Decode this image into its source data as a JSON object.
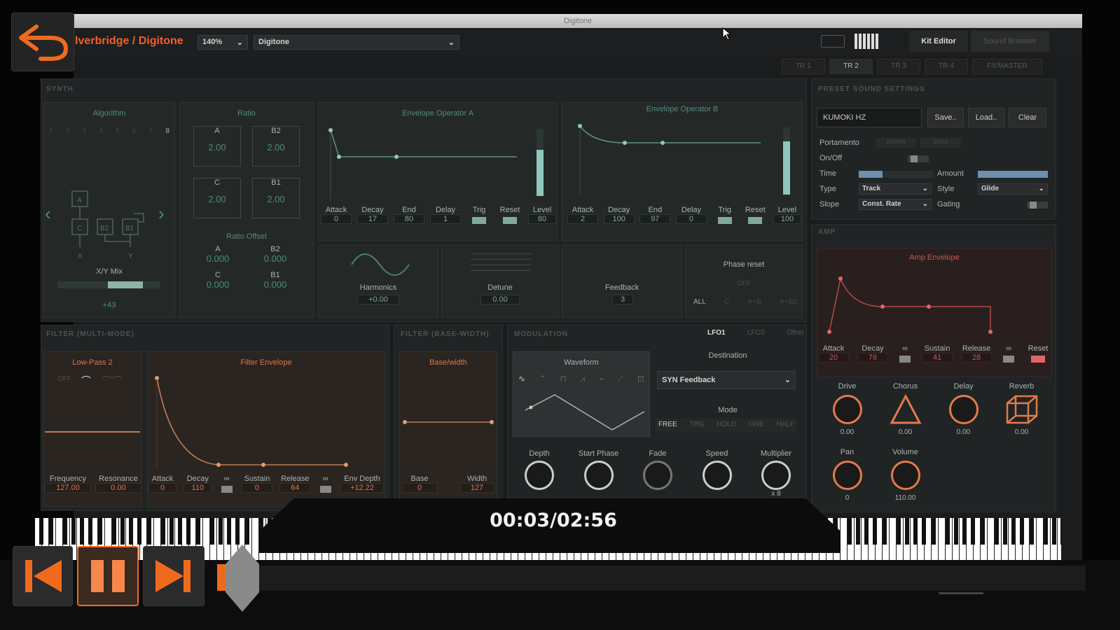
{
  "window": {
    "title": "Digitone"
  },
  "header": {
    "breadcrumb": "lverbridge / Digitone",
    "zoom": "140%",
    "device": "Digitone",
    "kit_editor": "Kit Editor",
    "sound_browser": "Sound Browser",
    "tracks": [
      "TR 1",
      "TR 2",
      "TR 3",
      "TR 4",
      "FX/MASTER"
    ]
  },
  "synth": {
    "title": "SYNTH",
    "algorithm": {
      "label": "Algorithm",
      "numbers": [
        "1",
        "2",
        "3",
        "4",
        "5",
        "6",
        "7",
        "8"
      ],
      "ops": [
        "A",
        "C",
        "B2",
        "B1"
      ],
      "xy": "X/Y Mix",
      "xy_value": "+43",
      "x": "X",
      "y": "Y"
    },
    "ratio": {
      "label": "Ratio",
      "a_label": "A",
      "b2_label": "B2",
      "c_label": "C",
      "b1_label": "B1",
      "a": "2.00",
      "b2": "2.00",
      "c": "2.00",
      "b1": "2.00",
      "offset_label": "Ratio Offset",
      "oa": "0.000",
      "ob2": "0.000",
      "oc": "0.000",
      "ob1": "0.000"
    },
    "env_a": {
      "label": "Envelope Operator A",
      "attack": "0",
      "decay": "17",
      "end": "80",
      "delay": "1",
      "level": "80"
    },
    "env_b": {
      "label": "Envelope Operator B",
      "attack": "2",
      "decay": "100",
      "end": "97",
      "delay": "0",
      "level": "100"
    },
    "labels": {
      "attack": "Attack",
      "decay": "Decay",
      "end": "End",
      "delay": "Delay",
      "trig": "Trig",
      "reset": "Reset",
      "level": "Level"
    },
    "harmonics": {
      "label": "Harmonics",
      "value": "+0.00"
    },
    "detune": {
      "label": "Detune",
      "value": "0.00"
    },
    "feedback": {
      "label": "Feedback",
      "value": "3"
    },
    "phase_reset": {
      "label": "Phase reset",
      "off": "OFF",
      "all": "ALL",
      "c": "C",
      "ab": "A+B",
      "ab2": "A+B2"
    }
  },
  "preset": {
    "title": "PRESET SOUND SETTINGS",
    "name": "KUMOKI HZ",
    "save": "Save..",
    "load": "Load..",
    "clear": "Clear",
    "portamento": "Portamento",
    "porta_a": "Bucket",
    "porta_b": "Bass",
    "onoff": "On/Off",
    "time": "Time",
    "amount": "Amount",
    "type": "Type",
    "type_val": "Track",
    "style": "Style",
    "style_val": "Glide",
    "slope": "Slope",
    "slope_val": "Const. Rate",
    "gating": "Gating"
  },
  "amp": {
    "title": "AMP",
    "env_label": "Amp Envelope",
    "attack": "Attack",
    "decay": "Decay",
    "hold": "∞",
    "sustain": "Sustain",
    "release": "Release",
    "reset": "Reset",
    "attack_v": "20",
    "decay_v": "76",
    "sustain_v": "41",
    "release_v": "28",
    "drive": "Drive",
    "chorus": "Chorus",
    "delay": "Delay",
    "reverb": "Reverb",
    "drive_v": "0.00",
    "chorus_v": "0.00",
    "delay_v": "0.00",
    "reverb_v": "0.00",
    "pan": "Pan",
    "volume": "Volume",
    "pan_v": "0",
    "volume_v": "110.00"
  },
  "filter": {
    "title": "FILTER (MULTI-MODE)",
    "mode": "Low-Pass 2",
    "off": "OFF",
    "env_label": "Filter Envelope",
    "frequency": "Frequency",
    "resonance": "Resonance",
    "freq_v": "127.00",
    "res_v": "0.00",
    "attack": "Attack",
    "decay": "Decay",
    "hold": "∞",
    "sustain": "Sustain",
    "release": "Release",
    "hold2": "∞",
    "envdepth": "Env Depth",
    "attack_v": "0",
    "decay_v": "110",
    "sustain_v": "0",
    "release_v": "64",
    "envdepth_v": "+12.22"
  },
  "basewidth": {
    "title": "FILTER (BASE-WIDTH)",
    "label": "Base/width",
    "base": "Base",
    "width": "Width",
    "base_v": "0",
    "width_v": "127"
  },
  "modulation": {
    "title": "MODULATION",
    "tabs": [
      "LFO1",
      "LFO2",
      "Other"
    ],
    "waveform": "Waveform",
    "destination": "Destination",
    "dest_val": "SYN Feedback",
    "mode": "Mode",
    "modes": [
      "FREE",
      "TRG",
      "HOLD",
      "ONE",
      "HALF"
    ],
    "depth": "Depth",
    "start_phase": "Start Phase",
    "fade": "Fade",
    "speed": "Speed",
    "multiplier": "Multiplier",
    "mult_v": "x 8"
  },
  "player": {
    "time": "00:03/02:56"
  },
  "colors": {
    "accent": "#f0612a",
    "teal": "#4f8a7f",
    "amp_red": "#c95555"
  }
}
